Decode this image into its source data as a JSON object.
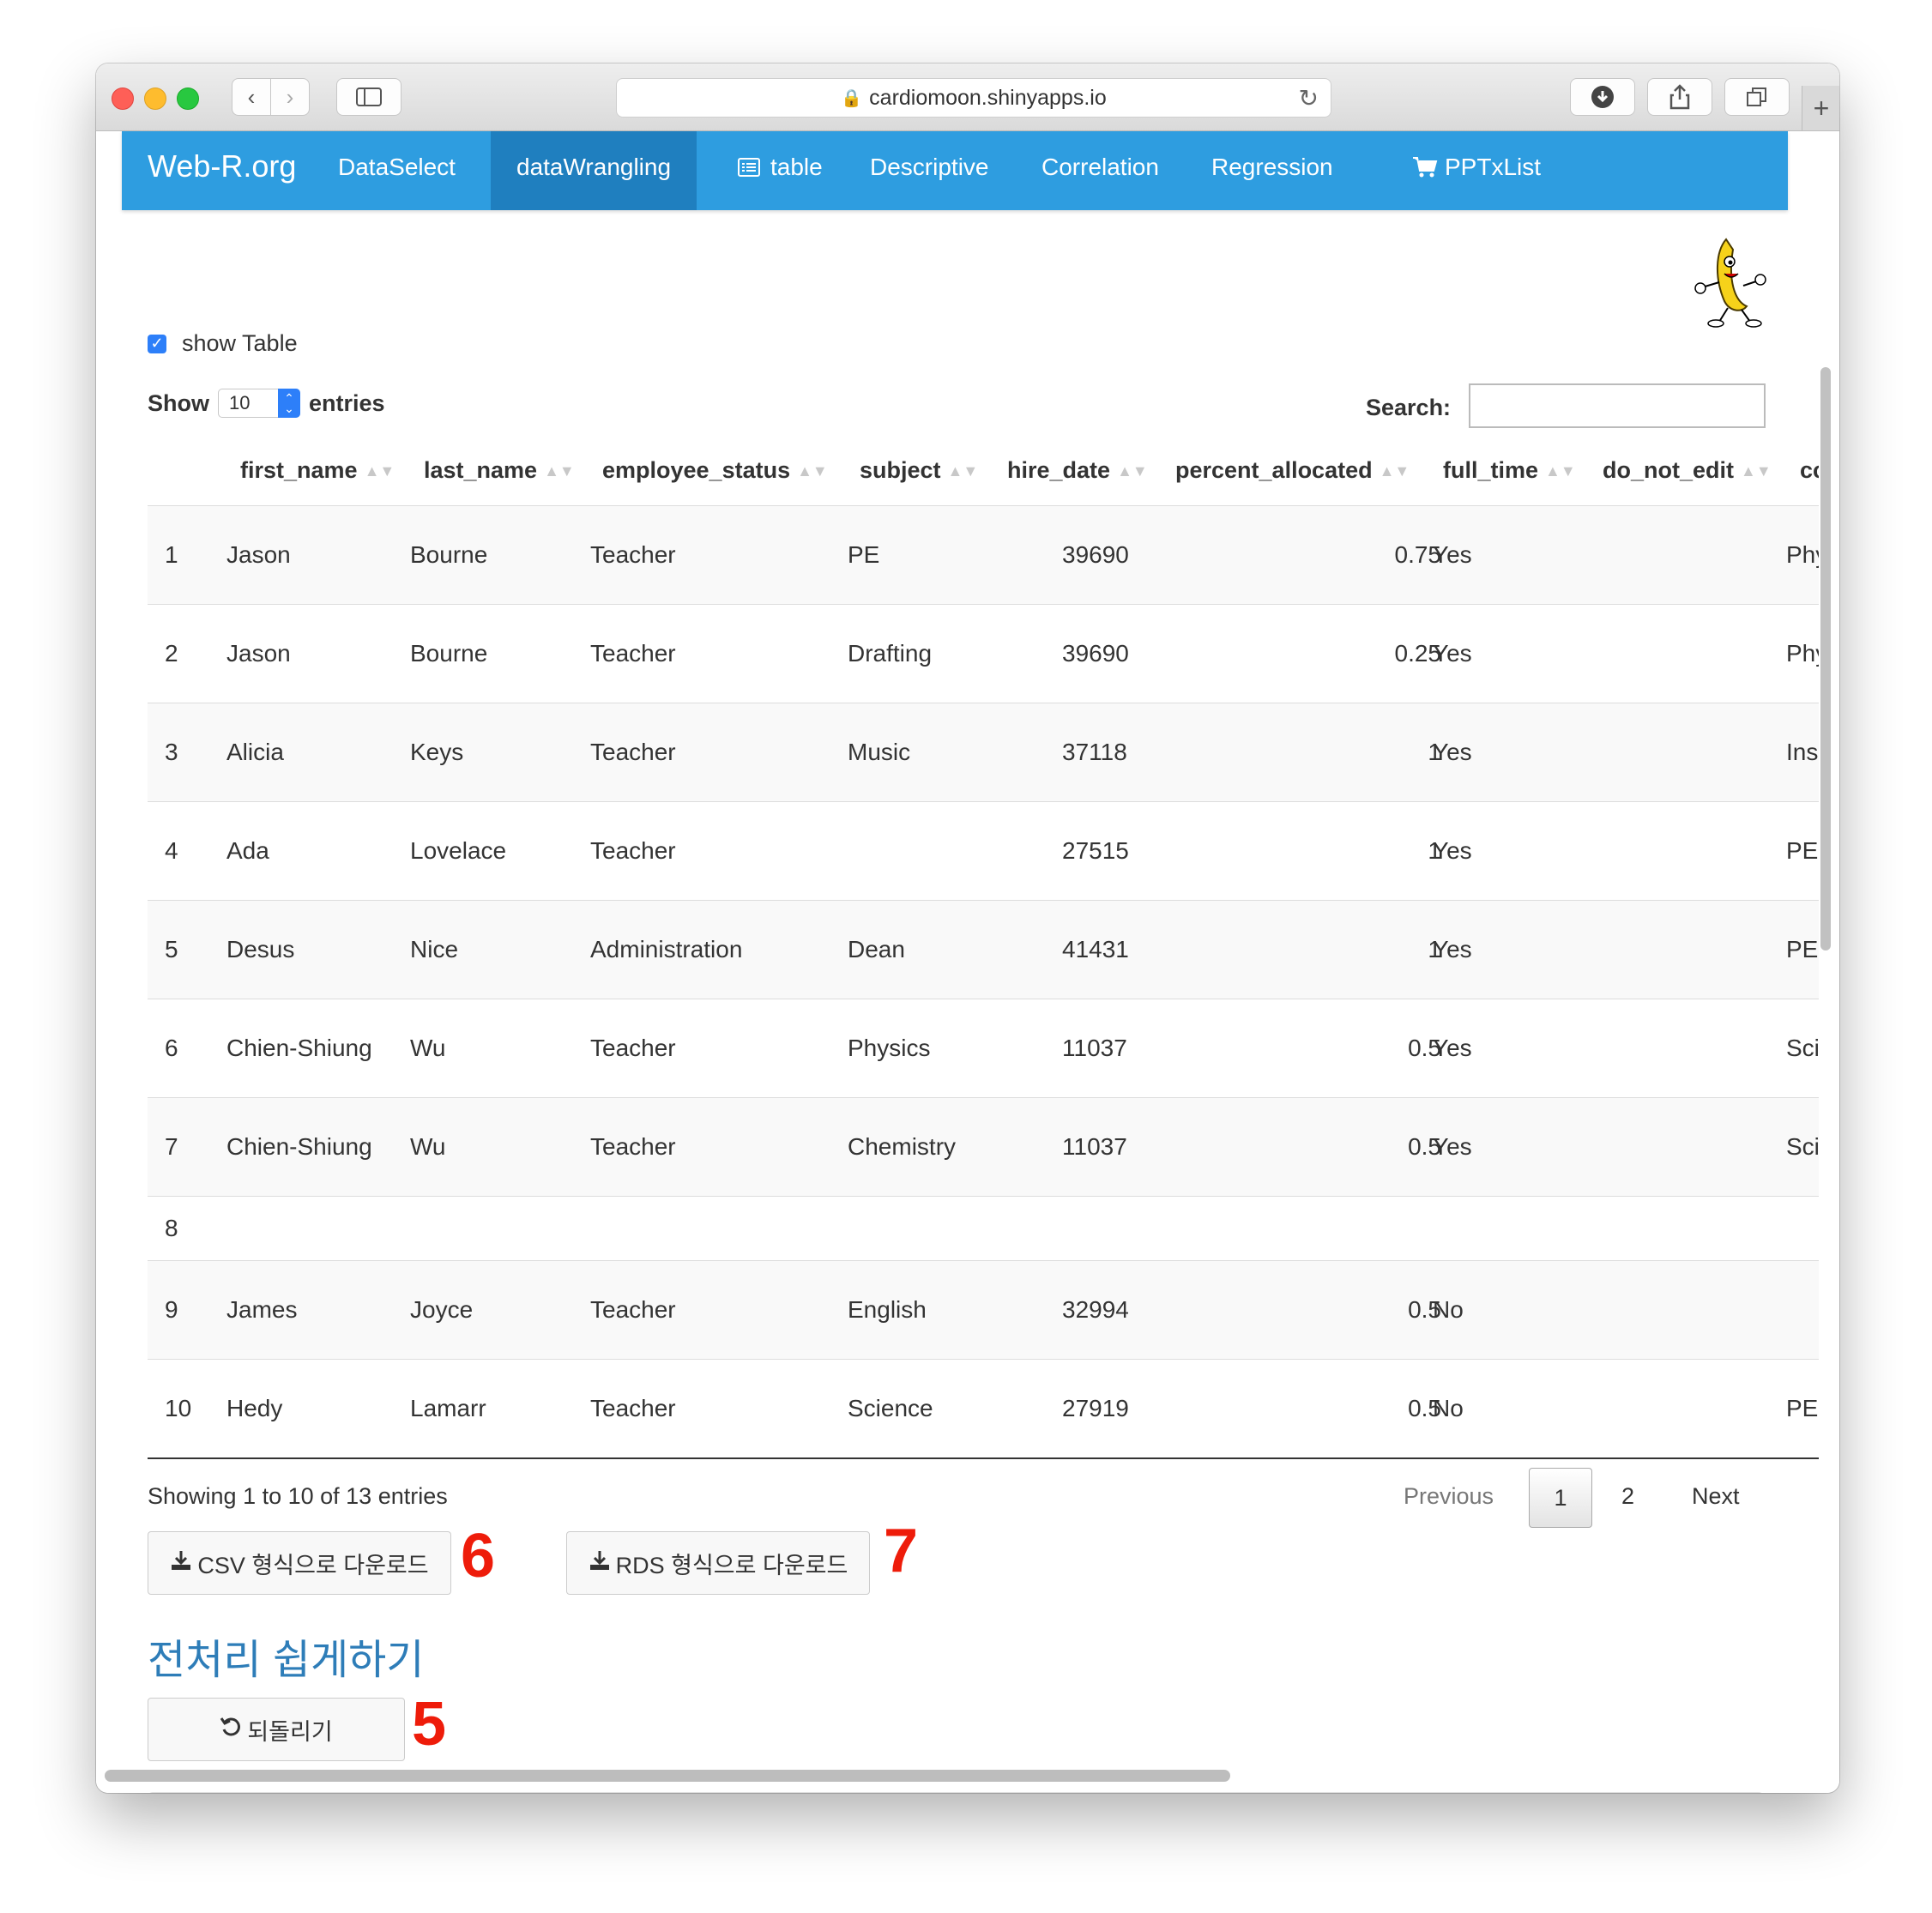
{
  "browser": {
    "url": "cardiomoon.shinyapps.io"
  },
  "navbar": {
    "brand": "Web-R.org",
    "items": [
      {
        "label": "DataSelect"
      },
      {
        "label": "dataWrangling",
        "active": true
      },
      {
        "label": "table",
        "icon": "list-icon"
      },
      {
        "label": "Descriptive"
      },
      {
        "label": "Correlation"
      },
      {
        "label": "Regression"
      },
      {
        "label": "PPTxList",
        "icon": "cart-icon"
      }
    ]
  },
  "show_table": {
    "label": "show Table",
    "checked": true
  },
  "length_control": {
    "show_label": "Show",
    "value": "10",
    "entries_label": "entries"
  },
  "search": {
    "label": "Search:",
    "value": ""
  },
  "table": {
    "columns": [
      "first_name",
      "last_name",
      "employee_status",
      "subject",
      "hire_date",
      "percent_allocated",
      "full_time",
      "do_not_edit",
      "cc"
    ],
    "rows": [
      {
        "idx": "1",
        "first_name": "Jason",
        "last_name": "Bourne",
        "employee_status": "Teacher",
        "subject": "PE",
        "hire_date": "39690",
        "percent_allocated": "0.75",
        "full_time": "Yes",
        "do_not_edit": "",
        "cc": "Phy"
      },
      {
        "idx": "2",
        "first_name": "Jason",
        "last_name": "Bourne",
        "employee_status": "Teacher",
        "subject": "Drafting",
        "hire_date": "39690",
        "percent_allocated": "0.25",
        "full_time": "Yes",
        "do_not_edit": "",
        "cc": "Phy"
      },
      {
        "idx": "3",
        "first_name": "Alicia",
        "last_name": "Keys",
        "employee_status": "Teacher",
        "subject": "Music",
        "hire_date": "37118",
        "percent_allocated": "1",
        "full_time": "Yes",
        "do_not_edit": "",
        "cc": "Ins"
      },
      {
        "idx": "4",
        "first_name": "Ada",
        "last_name": "Lovelace",
        "employee_status": "Teacher",
        "subject": "",
        "hire_date": "27515",
        "percent_allocated": "1",
        "full_time": "Yes",
        "do_not_edit": "",
        "cc": "PE"
      },
      {
        "idx": "5",
        "first_name": "Desus",
        "last_name": "Nice",
        "employee_status": "Administration",
        "subject": "Dean",
        "hire_date": "41431",
        "percent_allocated": "1",
        "full_time": "Yes",
        "do_not_edit": "",
        "cc": "PE"
      },
      {
        "idx": "6",
        "first_name": "Chien-Shiung",
        "last_name": "Wu",
        "employee_status": "Teacher",
        "subject": "Physics",
        "hire_date": "11037",
        "percent_allocated": "0.5",
        "full_time": "Yes",
        "do_not_edit": "",
        "cc": "Sci"
      },
      {
        "idx": "7",
        "first_name": "Chien-Shiung",
        "last_name": "Wu",
        "employee_status": "Teacher",
        "subject": "Chemistry",
        "hire_date": "11037",
        "percent_allocated": "0.5",
        "full_time": "Yes",
        "do_not_edit": "",
        "cc": "Sci"
      },
      {
        "idx": "8",
        "first_name": "",
        "last_name": "",
        "employee_status": "",
        "subject": "",
        "hire_date": "",
        "percent_allocated": "",
        "full_time": "",
        "do_not_edit": "",
        "cc": ""
      },
      {
        "idx": "9",
        "first_name": "James",
        "last_name": "Joyce",
        "employee_status": "Teacher",
        "subject": "English",
        "hire_date": "32994",
        "percent_allocated": "0.5",
        "full_time": "No",
        "do_not_edit": "",
        "cc": ""
      },
      {
        "idx": "10",
        "first_name": "Hedy",
        "last_name": "Lamarr",
        "employee_status": "Teacher",
        "subject": "Science",
        "hire_date": "27919",
        "percent_allocated": "0.5",
        "full_time": "No",
        "do_not_edit": "",
        "cc": "PE"
      }
    ]
  },
  "table_info": "Showing 1 to 10 of 13 entries",
  "pagination": {
    "previous": "Previous",
    "pages": [
      "1",
      "2"
    ],
    "current": "1",
    "next": "Next"
  },
  "downloads": {
    "csv_label": "CSV 형식으로 다운로드",
    "rds_label": "RDS 형식으로 다운로드"
  },
  "section": {
    "heading": "전처리 쉽게하기",
    "undo_label": "되돌리기"
  },
  "annotations": {
    "csv_marker": "6",
    "rds_marker": "7",
    "undo_marker": "5"
  },
  "colors": {
    "navbar": "#2e9de0",
    "navbar_active": "#1f7fbf",
    "heading": "#2e7db8",
    "marker": "#ee1c0a"
  }
}
